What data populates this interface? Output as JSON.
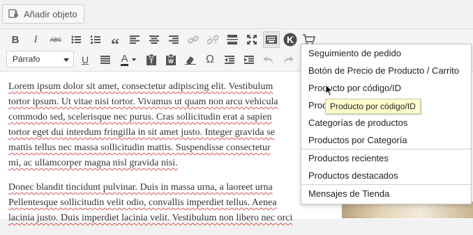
{
  "add_media": {
    "label": "Añadir objeto"
  },
  "toolbar": {
    "row1": [
      "bold-icon",
      "italic-icon",
      "strikethrough-icon",
      "bullet-list-icon",
      "numbered-list-icon",
      "blockquote-icon",
      "align-left-icon",
      "align-center-icon",
      "align-right-icon",
      "link-icon",
      "unlink-icon",
      "more-tag-icon",
      "fullscreen-icon",
      "keyboard-icon",
      "k-logo-icon",
      "cart-icon"
    ],
    "format_select": "Párrafo",
    "row2": [
      "underline-icon",
      "justify-icon",
      "text-color-icon",
      "paste-text-icon",
      "paste-word-icon",
      "clear-format-icon",
      "omega-icon",
      "outdent-icon",
      "indent-icon",
      "undo-icon",
      "redo-icon"
    ],
    "bold_glyph": "B",
    "italic_glyph": "I",
    "strike_glyph": "ABC",
    "quote_glyph": "“",
    "underline_glyph": "U",
    "color_glyph": "A",
    "omega_glyph": "Ω",
    "k_glyph": "K"
  },
  "content": {
    "p1_lines": [
      "Lorem ipsum dolor sit amet, consectetur adipiscing elit. Vestibulum",
      "tortor ipsum. Ut vitae nisi tortor. Vivamus ut quam non arcu vehicula",
      "commodo sed, scelerisque nec purus. Cras sollicitudin erat a sapien",
      "tortor eget dui interdum fringilla in sit amet justo. Integer gravida se",
      "mattis tellus nec massa sollicitudin mattis. Suspendisse consectetur",
      "mi, ac ullamcorper magna nisl gravida nisi."
    ],
    "p2_lines": [
      "Donec blandit tincidunt pulvinar. Duis in massa urna, a laoreet urna",
      "Pellentesque sollicitudin velit odio, convallis imperdiet tellus. Aenea",
      "lacinia justo. Duis imperdiet lacinia velit. Vestibulum non libero nec orci"
    ]
  },
  "menu": {
    "items_group1": [
      "Seguimiento de pedido",
      "Botón de Precio de Producto / Carrito",
      "Producto por código/ID",
      "Productos",
      "Categorías de productos",
      "Productos por Categoría"
    ],
    "items_group2": [
      "Productos recientes",
      "Productos destacados"
    ],
    "items_group3": [
      "Mensajes de Tienda"
    ]
  },
  "tooltip": "Producto por código/ID"
}
